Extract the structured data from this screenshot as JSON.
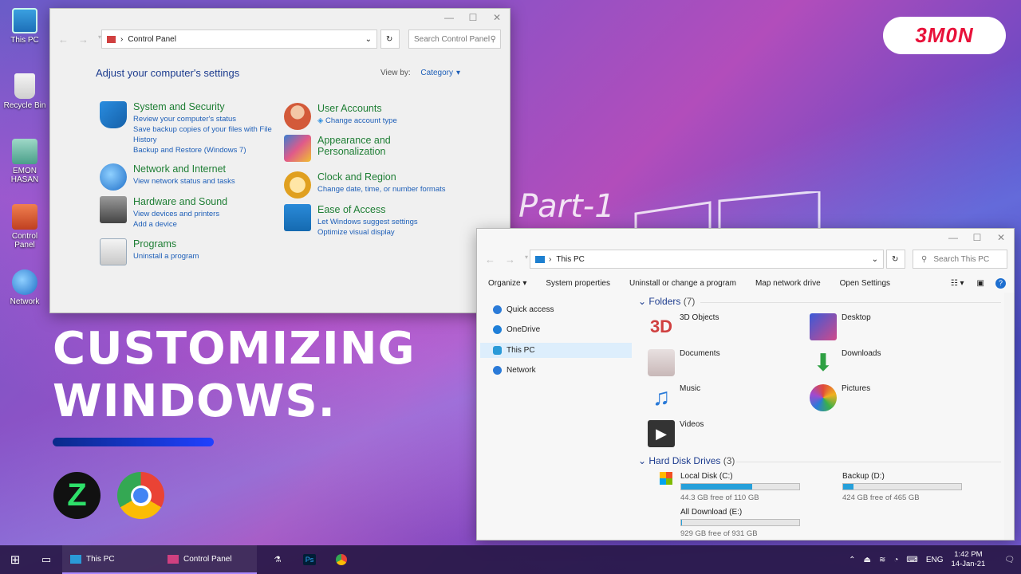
{
  "desktop": {
    "icons": [
      {
        "label": "This PC"
      },
      {
        "label": "Recycle Bin"
      },
      {
        "label": "EMON HASAN"
      },
      {
        "label": "Control Panel"
      },
      {
        "label": "Network"
      }
    ],
    "brand": "3M0N",
    "part_label": "Part-1",
    "title_line1": "CUSTOMIZING",
    "title_line2": "WINDOWS."
  },
  "control_panel": {
    "breadcrumb": "Control Panel",
    "search_placeholder": "Search Control Panel",
    "heading": "Adjust your computer's settings",
    "view_by_label": "View by:",
    "view_by_value": "Category",
    "categories_left": [
      {
        "title": "System and Security",
        "links": [
          "Review your computer's status",
          "Save backup copies of your files with File History",
          "Backup and Restore (Windows 7)"
        ]
      },
      {
        "title": "Network and Internet",
        "links": [
          "View network status and tasks"
        ]
      },
      {
        "title": "Hardware and Sound",
        "links": [
          "View devices and printers",
          "Add a device"
        ]
      },
      {
        "title": "Programs",
        "links": [
          "Uninstall a program"
        ]
      }
    ],
    "categories_right": [
      {
        "title": "User Accounts",
        "links": [
          "Change account type"
        ]
      },
      {
        "title": "Appearance and Personalization",
        "links": []
      },
      {
        "title": "Clock and Region",
        "links": [
          "Change date, time, or number formats"
        ]
      },
      {
        "title": "Ease of Access",
        "links": [
          "Let Windows suggest settings",
          "Optimize visual display"
        ]
      }
    ]
  },
  "explorer": {
    "breadcrumb": "This PC",
    "search_placeholder": "Search This PC",
    "toolbar": [
      "Organize",
      "System properties",
      "Uninstall or change a program",
      "Map network drive",
      "Open Settings"
    ],
    "nav": [
      "Quick access",
      "OneDrive",
      "This PC",
      "Network"
    ],
    "folders_title": "Folders",
    "folders_count": "(7)",
    "folders": [
      "3D Objects",
      "Desktop",
      "Documents",
      "Downloads",
      "Music",
      "Pictures",
      "Videos"
    ],
    "drives_title": "Hard Disk Drives",
    "drives_count": "(3)",
    "drives": [
      {
        "name": "Local Disk (C:)",
        "free": "44.3 GB free of 110 GB",
        "used_fraction": 0.6
      },
      {
        "name": "Backup (D:)",
        "free": "424 GB free of 465 GB",
        "used_fraction": 0.09
      },
      {
        "name": "All Download (E:)",
        "free": "929 GB free of 931 GB",
        "used_fraction": 0.002
      }
    ]
  },
  "taskbar": {
    "apps": [
      "This PC",
      "Control Panel"
    ],
    "language": "ENG",
    "time": "1:42 PM",
    "date": "14-Jan-21"
  },
  "colors": {
    "accent": "#26a0da",
    "link": "#1e5fb8",
    "category_title": "#1e7e34",
    "brand": "#e8123a"
  }
}
